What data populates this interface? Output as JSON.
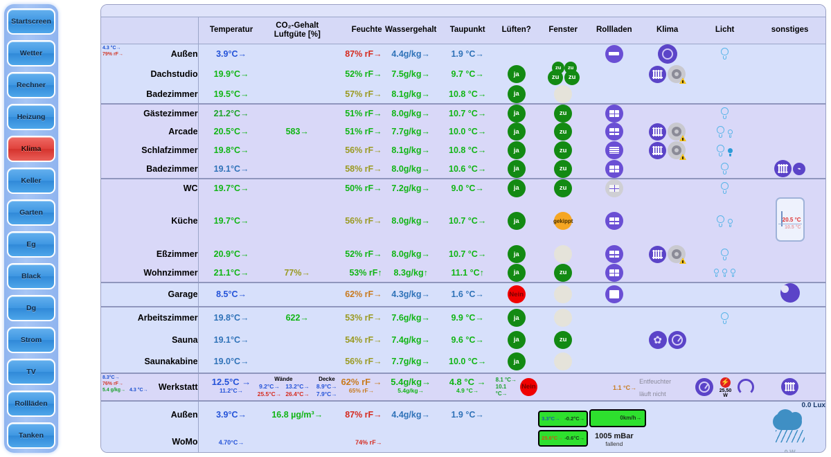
{
  "sidebar": {
    "items": [
      {
        "label": "Startscreen",
        "active": false
      },
      {
        "label": "Wetter",
        "active": false
      },
      {
        "label": "Rechner",
        "active": false
      },
      {
        "label": "Heizung",
        "active": false
      },
      {
        "label": "Klima",
        "active": true
      },
      {
        "label": "Keller",
        "active": false
      },
      {
        "label": "Garten",
        "active": false
      },
      {
        "label": "Eg",
        "active": false
      },
      {
        "label": "Black",
        "active": false
      },
      {
        "label": "Dg",
        "active": false
      },
      {
        "label": "Strom",
        "active": false
      },
      {
        "label": "TV",
        "active": false
      },
      {
        "label": "Rollläden",
        "active": false
      },
      {
        "label": "Tanken",
        "active": false
      }
    ],
    "active_color": "#e0423c",
    "button_color": "#3f97e2"
  },
  "headers": {
    "room": "",
    "temperatur": "Temperatur",
    "co2_line1": "CO₂-Gehalt",
    "co2_line2": "Luftgüte [%]",
    "feuchte": "Feuchte",
    "wassergehalt": "Wassergehalt",
    "taupunkt": "Taupunkt",
    "luften": "Lüften?",
    "fenster": "Fenster",
    "rollladen": "Rollladen",
    "klima": "Klima",
    "licht": "Licht",
    "sonstiges": "sonstiges"
  },
  "rows": [
    {
      "name": "Außen",
      "sub_left": [
        "4.3 °C→",
        "79% rF→"
      ],
      "temperatur": "3.9°C→",
      "co2": "",
      "feuchte": "87% rF→",
      "wassergehalt": "4.4g/kg→",
      "taupunkt": "1.9 °C→",
      "luften": "",
      "fenster": "",
      "rollladen": "open-bar",
      "klima": "knob",
      "licht": "one-bulb",
      "sonstiges": ""
    },
    {
      "name": "Dachstudio",
      "temperatur": "19.9°C→",
      "co2": "",
      "feuchte": "52% rF→",
      "wassergehalt": "7.5g/kg→",
      "taupunkt": "9.7 °C→",
      "luften": "ja",
      "fenster": "cluster4",
      "fenster_labels": [
        "zu",
        "zu",
        "zu",
        "zu"
      ],
      "rollladen": "",
      "klima": "radiator-gear",
      "licht": "",
      "sonstiges": ""
    },
    {
      "name": "Badezimmer",
      "temperatur": "19.5°C→",
      "co2": "",
      "feuchte": "57% rF→",
      "wassergehalt": "8.1g/kg→",
      "taupunkt": "10.8 °C→",
      "luften": "ja",
      "fenster": "gray",
      "rollladen": "",
      "klima": "",
      "licht": "",
      "sonstiges": "",
      "group_end": true
    },
    {
      "name": "Gästezimmer",
      "temperatur": "21.2°C→",
      "co2": "",
      "feuchte": "51% rF→",
      "wassergehalt": "8.0g/kg→",
      "taupunkt": "10.7 °C→",
      "luften": "ja",
      "fenster": "zu",
      "rollladen": "grid",
      "klima": "",
      "licht": "one-bulb",
      "sonstiges": ""
    },
    {
      "name": "Arcade",
      "temperatur": "20.5°C→",
      "co2": "583→",
      "feuchte": "51% rF→",
      "wassergehalt": "7.7g/kg→",
      "taupunkt": "10.0 °C→",
      "luften": "ja",
      "fenster": "zu",
      "rollladen": "grid",
      "klima": "radiator-gear",
      "licht": "two-bulbs",
      "sonstiges": ""
    },
    {
      "name": "Schlafzimmer",
      "temperatur": "19.8°C→",
      "co2": "",
      "feuchte": "56% rF→",
      "wassergehalt": "8.1g/kg→",
      "taupunkt": "10.8 °C→",
      "luften": "ja",
      "fenster": "zu",
      "rollladen": "lines",
      "klima": "radiator-gear",
      "licht": "bulb-on",
      "sonstiges": ""
    },
    {
      "name": "Badezimmer",
      "temperatur": "19.1°C→",
      "co2": "",
      "feuchte": "58% rF→",
      "wassergehalt": "8.0g/kg→",
      "taupunkt": "10.6 °C→",
      "luften": "ja",
      "fenster": "zu",
      "rollladen": "grid",
      "klima": "",
      "licht": "one-bulb",
      "sonstiges": "radiator-small",
      "group_end": true
    },
    {
      "name": "WC",
      "temperatur": "19.7°C→",
      "co2": "",
      "feuchte": "50% rF→",
      "wassergehalt": "7.2g/kg→",
      "taupunkt": "9.0 °C→",
      "luften": "ja",
      "fenster": "zu",
      "rollladen": "grid-gray",
      "klima": "",
      "licht": "one-bulb",
      "sonstiges": ""
    },
    {
      "name": "Küche",
      "temperatur": "19.7°C→",
      "co2": "",
      "feuchte": "56% rF→",
      "wassergehalt": "8.0g/kg→",
      "taupunkt": "10.7 °C→",
      "luften": "ja",
      "fenster": "gekippt",
      "rollladen": "grid",
      "klima": "",
      "licht": "two-bulbs",
      "sonstiges": "fridge"
    },
    {
      "name": "Eßzimmer",
      "temperatur": "20.9°C→",
      "co2": "",
      "feuchte": "52% rF→",
      "wassergehalt": "8.0g/kg→",
      "taupunkt": "10.7 °C→",
      "luften": "ja",
      "fenster": "gray",
      "rollladen": "grid",
      "klima": "radiator-gear",
      "licht": "one-bulb",
      "sonstiges": ""
    },
    {
      "name": "Wohnzimmer",
      "temperatur": "21.1°C→",
      "co2": "77%→",
      "feuchte": "53% rF↑",
      "wassergehalt": "8.3g/kg↑",
      "taupunkt": "11.1 °C↑",
      "luften": "ja",
      "fenster": "zu",
      "rollladen": "grid",
      "klima": "",
      "licht": "three-bulbs",
      "sonstiges": "",
      "group_end": true
    },
    {
      "name": "Garage",
      "temperatur": "8.5°C→",
      "co2": "",
      "feuchte": "62% rF→",
      "wassergehalt": "4.3g/kg→",
      "taupunkt": "1.6 °C→",
      "luften": "Nein",
      "fenster": "gray",
      "rollladen": "closed",
      "klima": "",
      "licht": "",
      "sonstiges": "moon",
      "group_end": true
    },
    {
      "name": "Arbeitszimmer",
      "temperatur": "19.8°C→",
      "co2": "622→",
      "feuchte": "53% rF→",
      "wassergehalt": "7.6g/kg→",
      "taupunkt": "9.9 °C→",
      "luften": "ja",
      "fenster": "gray",
      "rollladen": "",
      "klima": "",
      "licht": "one-bulb",
      "sonstiges": ""
    },
    {
      "name": "Sauna",
      "temperatur": "19.1°C→",
      "co2": "",
      "feuchte": "54% rF→",
      "wassergehalt": "7.4g/kg→",
      "taupunkt": "9.6 °C→",
      "luften": "ja",
      "fenster": "zu",
      "rollladen": "",
      "klima": "fan-dial",
      "licht": "",
      "sonstiges": ""
    },
    {
      "name": "Saunakabine",
      "temperatur": "19.0°C→",
      "co2": "",
      "feuchte": "56% rF→",
      "wassergehalt": "7.7g/kg→",
      "taupunkt": "10.0 °C→",
      "luften": "ja",
      "fenster": "gray",
      "rollladen": "",
      "klima": "",
      "licht": "",
      "sonstiges": "",
      "group_end": true
    }
  ],
  "werkstatt": {
    "name": "Werkstatt",
    "sub_left": [
      "8.3°C→",
      "76% rF→",
      "5.4 g/kg→",
      "4.3 °C→"
    ],
    "temp_big": "12.5°C →",
    "temp_small": "11.2°C→",
    "waende_caption": "Wände",
    "waende": [
      {
        "a": "9.2°C→",
        "b": "25.5°C→"
      },
      {
        "a": "13.2°C→",
        "b": "26.4°C→"
      }
    ],
    "decke_caption": "Decke",
    "decke": {
      "a": "8.9°C→",
      "b": "7.9°C→"
    },
    "feuchte_big": "62% rF →",
    "feuchte_small": "65% rF→",
    "wasser_big": "5.4g/kg→",
    "wasser_small": "5.4g/kg→",
    "taupunkt_big": "4.8 °C →",
    "taupunkt_small": "4.9 °C→",
    "vent_pair": [
      "8.1 °C→",
      "10.1 °C→"
    ],
    "luften": "Nein",
    "extra_temp": "1.1 °C→",
    "note_line1": "Entfeuchter",
    "note_line2": "läuft nicht",
    "power": "25,50 W"
  },
  "bottom": {
    "aussen": {
      "name": "Außen",
      "temperatur": "3.9°C→",
      "feinstaub": "16.8 µg/m³→",
      "feuchte": "87% rF→",
      "wassergehalt": "4.4g/kg→",
      "taupunkt": "1.9 °C→"
    },
    "womo": {
      "name": "WoMo",
      "temperatur": "4.70°C→",
      "feuchte": "74% rF→"
    },
    "lcd1": {
      "left": "3.3°C→",
      "right": "-0.2°C→"
    },
    "lcd2": {
      "left": "25.6°C→",
      "right": "-0.6°C→"
    },
    "wind": {
      "right": "0km/h→"
    },
    "pressure": "1005 mBar",
    "trend": "fallend",
    "lux": "0.0 Lux",
    "watt": "0 W"
  }
}
